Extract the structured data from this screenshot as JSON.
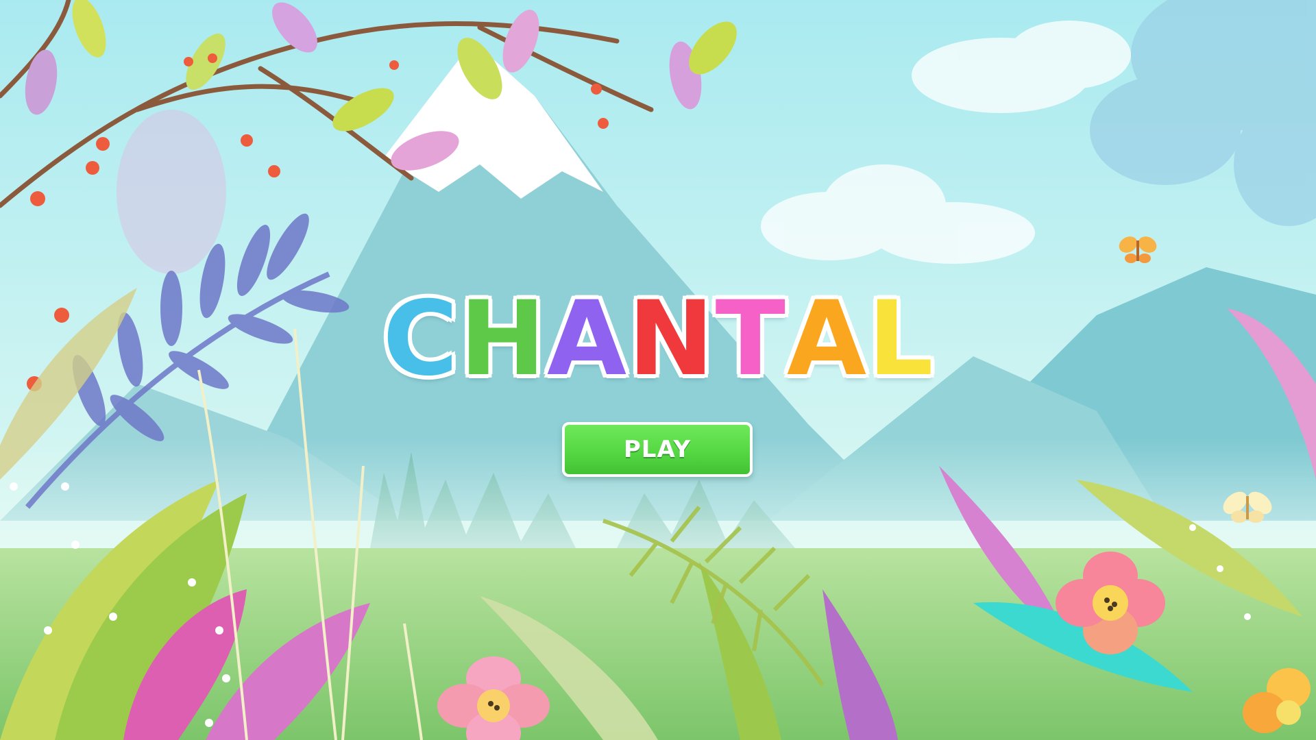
{
  "game": {
    "title_letters": [
      {
        "char": "C",
        "color": "#47bfe8"
      },
      {
        "char": "H",
        "color": "#5ec948"
      },
      {
        "char": "A",
        "color": "#9062f0"
      },
      {
        "char": "N",
        "color": "#f0393c"
      },
      {
        "char": "T",
        "color": "#f561c6"
      },
      {
        "char": "A",
        "color": "#fba61f"
      },
      {
        "char": "L",
        "color": "#f9e23a"
      }
    ],
    "play_label": "PLAY"
  },
  "colors": {
    "sky_top": "#b4eef2",
    "sky_bottom": "#d9f6f0",
    "mountain": "#8fd3da",
    "meadow": "#9fd889",
    "button_green": "#55d843"
  },
  "icons": [
    "butterfly-icon",
    "flower-icon",
    "leaf-icon",
    "berry-icon",
    "cloud-icon",
    "mountain-icon"
  ]
}
